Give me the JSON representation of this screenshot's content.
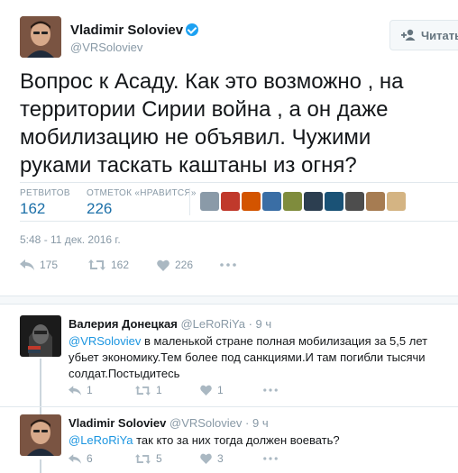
{
  "author": {
    "name": "Vladimir Soloviev",
    "handle": "@VRSoloviev",
    "follow_label": "Читать"
  },
  "tweet": {
    "text": "Вопрос к Асаду. Как это возможно , на территории Сирии война , а он даже мобилизацию не объявил. Чужими руками таскать каштаны из огня?",
    "timestamp": "5:48 - 11 дек. 2016 г."
  },
  "stats": {
    "retweets_label": "РЕТВИТОВ",
    "retweets_value": "162",
    "likes_label": "ОТМЕТОК «НРАВИТСЯ»",
    "likes_value": "226"
  },
  "likers": [
    {
      "name": "liker-1",
      "color": "#8a9aa8"
    },
    {
      "name": "liker-2",
      "color": "#c0392b"
    },
    {
      "name": "liker-3",
      "color": "#d35400"
    },
    {
      "name": "liker-4",
      "color": "#3a6ea5"
    },
    {
      "name": "liker-5",
      "color": "#7f8c3d"
    },
    {
      "name": "liker-6",
      "color": "#2c3e50"
    },
    {
      "name": "liker-7",
      "color": "#1a5276"
    },
    {
      "name": "liker-8",
      "color": "#4d4d4d"
    },
    {
      "name": "liker-9",
      "color": "#a67c52"
    },
    {
      "name": "liker-10",
      "color": "#d4b483"
    }
  ],
  "actions": {
    "reply_count": "175",
    "retweet_count": "162",
    "like_count": "226"
  },
  "replies": [
    {
      "name": "Валерия Донецкая",
      "handle": "@LeRoRiYa",
      "time": "· 9 ч",
      "mention": "@VRSoloviev",
      "text": " в маленькой стране полная мобилизация за 5,5 лет убьет экономику.Тем более под санкциями.И там погибли тысячи солдат.Постыдитесь",
      "reply_count": "1",
      "retweet_count": "1",
      "like_count": "1"
    },
    {
      "name": "Vladimir Soloviev",
      "handle": "@VRSoloviev",
      "time": "· 9 ч",
      "mention": "@LeRoRiYa",
      "text": " так кто за них тогда должен воевать?",
      "reply_count": "6",
      "retweet_count": "5",
      "like_count": "3"
    }
  ],
  "colors": {
    "accent": "#1b95e0",
    "muted": "#8899a6",
    "text": "#14171a"
  }
}
